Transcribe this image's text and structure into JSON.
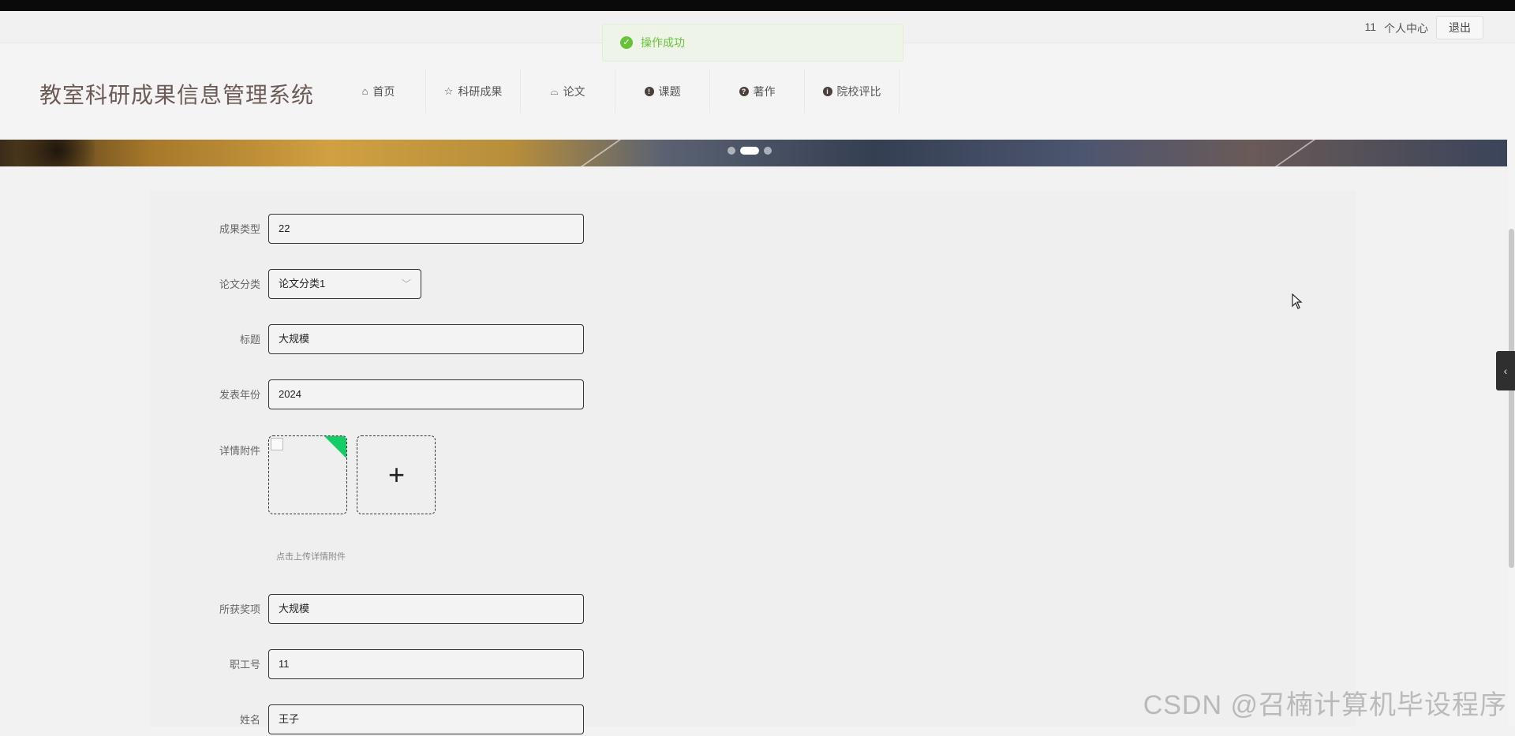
{
  "topbar": {
    "user": "11",
    "personal_center": "个人中心",
    "logout": "退出"
  },
  "toast": {
    "message": "操作成功"
  },
  "header": {
    "logo": "教室科研成果信息管理系统",
    "nav": [
      {
        "label": "首页",
        "icon": "home-icon"
      },
      {
        "label": "科研成果",
        "icon": "star-icon"
      },
      {
        "label": "论文",
        "icon": "bag-icon"
      },
      {
        "label": "课题",
        "icon": "exclamation-icon"
      },
      {
        "label": "著作",
        "icon": "question-icon"
      },
      {
        "label": "院校评比",
        "icon": "info-icon"
      }
    ]
  },
  "banner": {
    "slides": 3,
    "active_slide": 2
  },
  "form": {
    "achievement_type": {
      "label": "成果类型",
      "value": "22"
    },
    "paper_category": {
      "label": "论文分类",
      "value": "论文分类1"
    },
    "title": {
      "label": "标题",
      "value": "大规模"
    },
    "publish_year": {
      "label": "发表年份",
      "value": "2024"
    },
    "attachment": {
      "label": "详情附件",
      "tip": "点击上传详情附件"
    },
    "award": {
      "label": "所获奖项",
      "value": "大规模"
    },
    "employee_id": {
      "label": "职工号",
      "value": "11"
    },
    "name": {
      "label": "姓名",
      "value": "王子"
    }
  },
  "watermark": "CSDN @召楠计算机毕设程序",
  "colors": {
    "success": "#67c23a",
    "upload_corner": "#13ce66",
    "logo": "#6b5a55"
  }
}
